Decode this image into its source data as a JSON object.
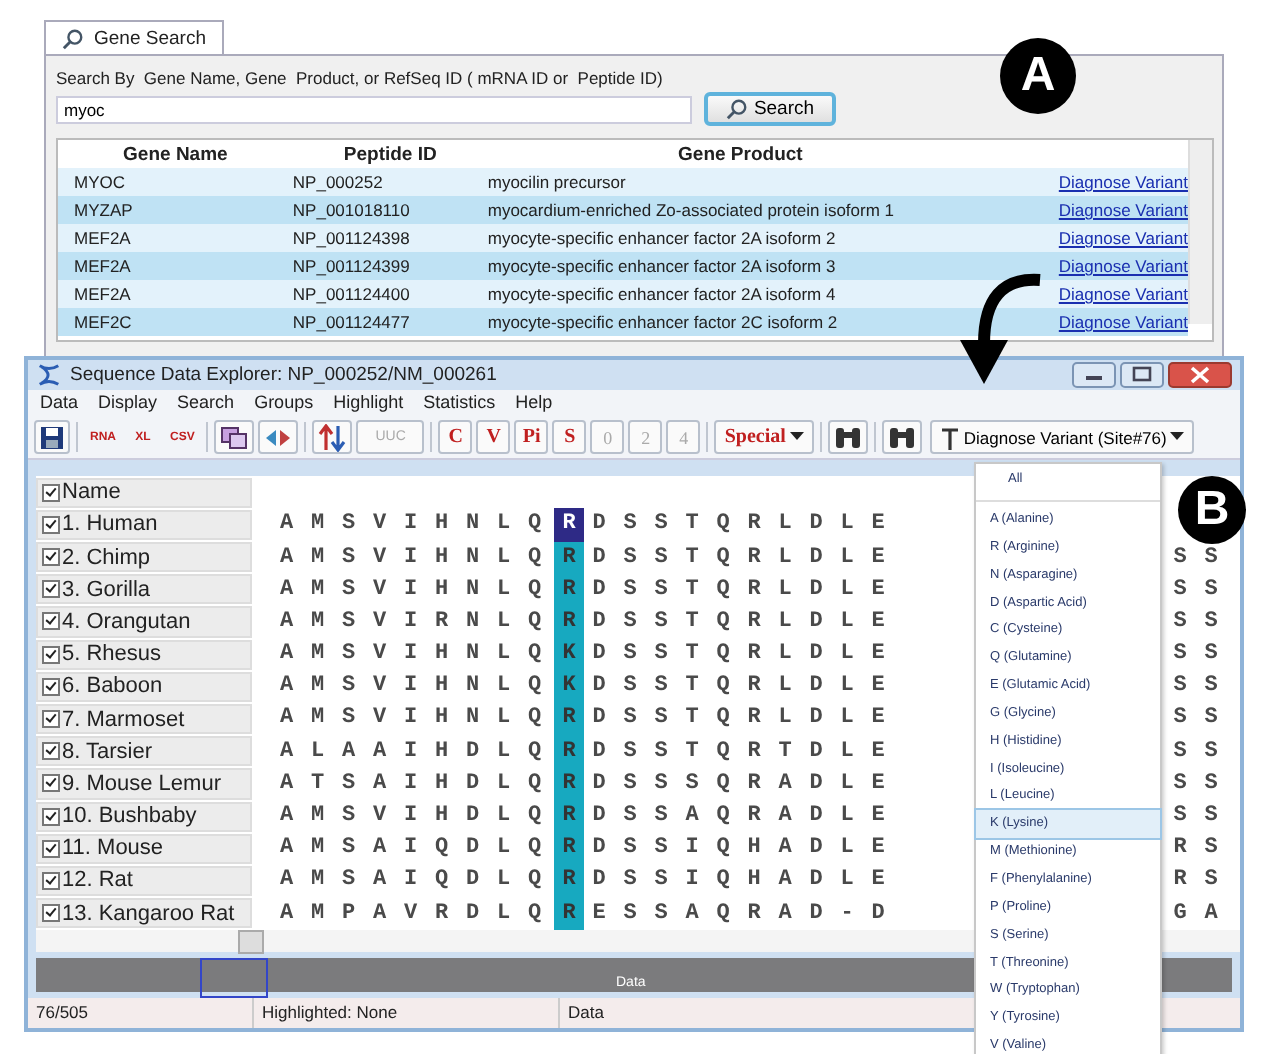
{
  "gene_search": {
    "tab": "Gene Search",
    "search_label": "Search By  Gene Name, Gene  Product, or RefSeq ID ( mRNA ID or  Peptide ID)",
    "query": "myoc",
    "search_button": "Search",
    "columns": [
      "Gene Name",
      "Peptide ID",
      "Gene Product"
    ],
    "rows": [
      {
        "gene": "MYOC",
        "peptide": "NP_000252",
        "product": "myocilin precursor",
        "link": "Diagnose Variant"
      },
      {
        "gene": "MYZAP",
        "peptide": "NP_001018110",
        "product": "myocardium-enriched Zo-associated protein isoform 1",
        "link": "Diagnose Variant"
      },
      {
        "gene": "MEF2A",
        "peptide": "NP_001124398",
        "product": "myocyte-specific enhancer factor 2A isoform 2",
        "link": "Diagnose Variant"
      },
      {
        "gene": "MEF2A",
        "peptide": "NP_001124399",
        "product": "myocyte-specific enhancer factor 2A isoform 3",
        "link": "Diagnose Variant"
      },
      {
        "gene": "MEF2A",
        "peptide": "NP_001124400",
        "product": "myocyte-specific enhancer factor 2A isoform 4",
        "link": "Diagnose Variant"
      },
      {
        "gene": "MEF2C",
        "peptide": "NP_001124477",
        "product": "myocyte-specific enhancer factor 2C isoform 2",
        "link": "Diagnose Variant"
      }
    ]
  },
  "explorer": {
    "title": "Sequence Data Explorer: NP_000252/NM_000261",
    "menu": [
      "Data",
      "Display",
      "Search",
      "Groups",
      "Highlight",
      "Statistics",
      "Help"
    ],
    "export_buttons": [
      "RNA",
      "XL",
      "CSV"
    ],
    "codon_button": {
      "label": "UUC",
      "disabled": true
    },
    "stat_buttons": [
      "C",
      "V",
      "Pi",
      "S"
    ],
    "count_buttons": [
      {
        "label": "0",
        "disabled": true
      },
      {
        "label": "2",
        "disabled": true
      },
      {
        "label": "4",
        "disabled": true
      }
    ],
    "special_button": "Special",
    "variant_button": "Diagnose Variant (Site#76)",
    "name_header": {
      "label": "Name",
      "checked": true
    },
    "sequences": [
      {
        "name": "1. Human",
        "checked": true,
        "selected": true,
        "before": "A M S V I H N L Q",
        "site": "R",
        "after": "D S S T Q R L D L E"
      },
      {
        "name": "2. Chimp",
        "checked": true,
        "selected": false,
        "before": "A M S V I H N L Q",
        "site": "R",
        "after": "D S S T Q R L D L E",
        "tail": "S S"
      },
      {
        "name": "3. Gorilla",
        "checked": true,
        "selected": false,
        "before": "A M S V I H N L Q",
        "site": "R",
        "after": "D S S T Q R L D L E",
        "tail": "S S"
      },
      {
        "name": "4. Orangutan",
        "checked": true,
        "selected": false,
        "before": "A M S V I R N L Q",
        "site": "R",
        "after": "D S S T Q R L D L E",
        "tail": "S S"
      },
      {
        "name": "5. Rhesus",
        "checked": true,
        "selected": false,
        "before": "A M S V I H N L Q",
        "site": "K",
        "after": "D S S T Q R L D L E",
        "tail": "S S"
      },
      {
        "name": "6. Baboon",
        "checked": true,
        "selected": false,
        "before": "A M S V I H N L Q",
        "site": "K",
        "after": "D S S T Q R L D L E",
        "tail": "S S"
      },
      {
        "name": "7. Marmoset",
        "checked": true,
        "selected": false,
        "before": "A M S V I H N L Q",
        "site": "R",
        "after": "D S S T Q R L D L E",
        "tail": "S S"
      },
      {
        "name": "8. Tarsier",
        "checked": true,
        "selected": false,
        "before": "A L A A I H D L Q",
        "site": "R",
        "after": "D S S T Q R T D L E",
        "tail": "S S"
      },
      {
        "name": "9. Mouse Lemur",
        "checked": true,
        "selected": false,
        "before": "A T S A I H D L Q",
        "site": "R",
        "after": "D S S S Q R A D L E",
        "tail": "S S"
      },
      {
        "name": "10. Bushbaby",
        "checked": true,
        "selected": false,
        "before": "A M S V I H D L Q",
        "site": "R",
        "after": "D S S A Q R A D L E",
        "tail": "S S"
      },
      {
        "name": "11. Mouse",
        "checked": true,
        "selected": false,
        "before": "A M S A I Q D L Q",
        "site": "R",
        "after": "D S S I Q H A D L E",
        "tail": "R S"
      },
      {
        "name": "12. Rat",
        "checked": true,
        "selected": false,
        "before": "A M S A I Q D L Q",
        "site": "R",
        "after": "D S S I Q H A D L E",
        "tail": "R S"
      },
      {
        "name": "13. Kangaroo Rat",
        "checked": true,
        "selected": false,
        "before": "A M P A V R D L Q",
        "site": "R",
        "after": "E S S A Q R A D - D",
        "tail": "G A"
      }
    ],
    "overview_label": "Data",
    "status": [
      "76/505",
      "Highlighted: None",
      "Data"
    ]
  },
  "variant_menu": {
    "items": [
      {
        "label": "All",
        "selected": false
      },
      {
        "label": "A (Alanine)",
        "selected": false
      },
      {
        "label": "R (Arginine)",
        "selected": false
      },
      {
        "label": "N (Asparagine)",
        "selected": false
      },
      {
        "label": "D (Aspartic Acid)",
        "selected": false
      },
      {
        "label": "C (Cysteine)",
        "selected": false
      },
      {
        "label": "Q (Glutamine)",
        "selected": false
      },
      {
        "label": "E (Glutamic Acid)",
        "selected": false
      },
      {
        "label": "G (Glycine)",
        "selected": false
      },
      {
        "label": "H (Histidine)",
        "selected": false
      },
      {
        "label": "I (Isoleucine)",
        "selected": false
      },
      {
        "label": "L (Leucine)",
        "selected": false
      },
      {
        "label": "K (Lysine)",
        "selected": true
      },
      {
        "label": "M (Methionine)",
        "selected": false
      },
      {
        "label": "F (Phenylalanine)",
        "selected": false
      },
      {
        "label": "P (Proline)",
        "selected": false
      },
      {
        "label": "S (Serine)",
        "selected": false
      },
      {
        "label": "T (Threonine)",
        "selected": false
      },
      {
        "label": "W (Tryptophan)",
        "selected": false
      },
      {
        "label": "Y (Tyrosine)",
        "selected": false
      },
      {
        "label": "V (Valine)",
        "selected": false
      }
    ]
  },
  "callouts": [
    "A",
    "B"
  ]
}
